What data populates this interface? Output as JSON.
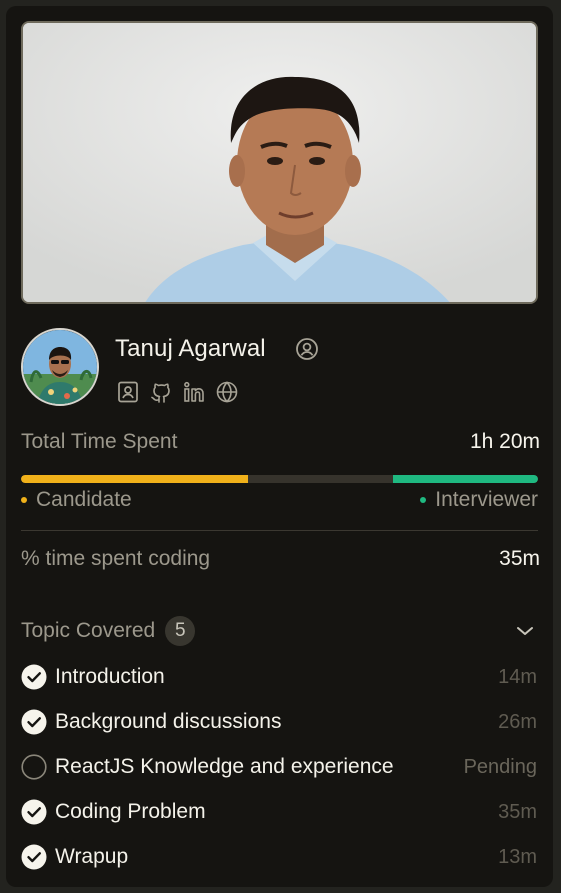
{
  "candidate": {
    "name": "Tanuj Agarwal",
    "icons": {
      "profile_badge": "user-circle-icon",
      "socials": [
        "id-card-icon",
        "github-icon",
        "linkedin-icon",
        "globe-icon"
      ]
    }
  },
  "time": {
    "total_label": "Total Time Spent",
    "total_value": "1h 20m",
    "candidate_label": "Candidate",
    "interviewer_label": "Interviewer",
    "candidate_share": 0.44,
    "interviewer_share": 0.28,
    "colors": {
      "candidate": "#f0b11a",
      "interviewer": "#1fb981",
      "track": "#36332c"
    }
  },
  "coding": {
    "label": "% time spent coding",
    "value": "35m"
  },
  "topics": {
    "label": "Topic Covered",
    "count": "5",
    "items": [
      {
        "title": "Introduction",
        "duration": "14m",
        "done": true
      },
      {
        "title": "Background discussions",
        "duration": "26m",
        "done": true
      },
      {
        "title": "ReactJS Knowledge and experience",
        "duration": "Pending",
        "done": false
      },
      {
        "title": "Coding Problem",
        "duration": "35m",
        "done": true
      },
      {
        "title": "Wrapup",
        "duration": "13m",
        "done": true
      }
    ]
  }
}
